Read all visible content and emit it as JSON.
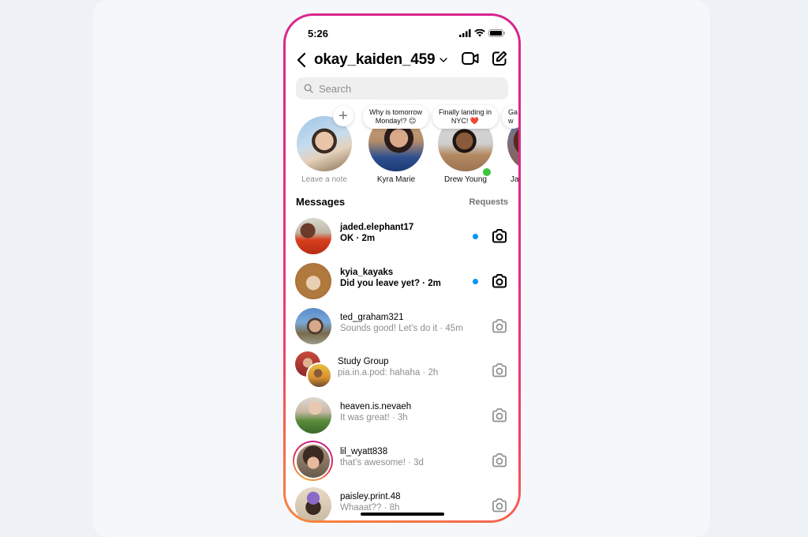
{
  "status_bar": {
    "time": "5:26",
    "icons": [
      "signal-icon",
      "wifi-icon",
      "battery-icon"
    ]
  },
  "header": {
    "username": "okay_kaiden_459",
    "back_icon": "chevron-left-icon",
    "dropdown_icon": "chevron-down-icon",
    "actions": [
      "video-camera-icon",
      "compose-icon"
    ]
  },
  "search": {
    "placeholder": "Search"
  },
  "stories": [
    {
      "name": "Leave a note",
      "note": null,
      "own": true
    },
    {
      "name": "Kyra Marie",
      "note_line1": "Why is tomorrow",
      "note_line2": "Monday!? 😑"
    },
    {
      "name": "Drew Young",
      "note_line1": "Finally landing in",
      "note_line2": "NYC! ❤️",
      "online": true
    },
    {
      "name": "Jad",
      "note_line1": "Ga",
      "note_line2": "w"
    }
  ],
  "messages_section": {
    "title": "Messages",
    "requests_label": "Requests"
  },
  "messages": [
    {
      "name": "jaded.elephant17",
      "preview": "OK · 2m",
      "unread": true
    },
    {
      "name": "kyia_kayaks",
      "preview": "Did you leave yet? · 2m",
      "unread": true
    },
    {
      "name": "ted_graham321",
      "preview": "Sounds good! Let’s do it · 45m",
      "unread": false
    },
    {
      "name": "Study Group",
      "preview": "pia.in.a.pod: hahaha · 2h",
      "unread": false,
      "group": true
    },
    {
      "name": "heaven.is.nevaeh",
      "preview": "It was great! · 3h",
      "unread": false
    },
    {
      "name": "lil_wyatt838",
      "preview": "that’s awesome! · 3d",
      "unread": false,
      "story_ring": true
    },
    {
      "name": "paisley.print.48",
      "preview": "Whaaat?? · 8h",
      "unread": false
    }
  ],
  "colors": {
    "unread_dot": "#0095f6",
    "online": "#3cc53c",
    "ring_start": "#d6248f",
    "ring_end": "#f7883a"
  }
}
